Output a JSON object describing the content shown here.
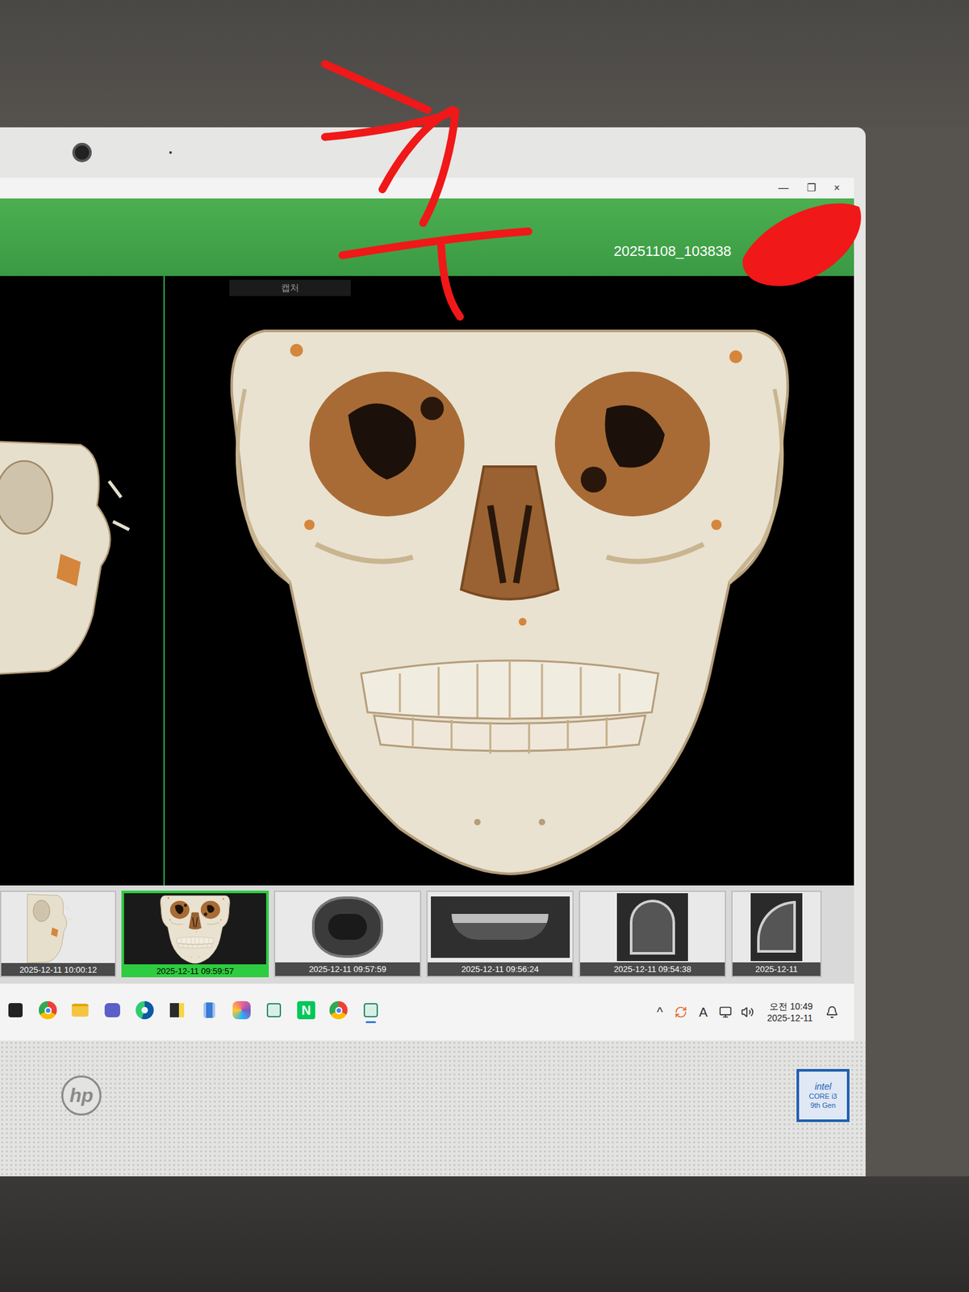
{
  "window": {
    "title": "20251108_103838",
    "controls": [
      "—",
      "❐",
      "×"
    ]
  },
  "viewer": {
    "tab_label": "캡처"
  },
  "thumbnails": [
    {
      "time": "2025-12-11 10:00:12",
      "selected": false,
      "kind": "3d-side"
    },
    {
      "time": "2025-12-11 09:59:57",
      "selected": true,
      "kind": "3d-front"
    },
    {
      "time": "2025-12-11 09:57:59",
      "selected": false,
      "kind": "axial"
    },
    {
      "time": "2025-12-11 09:56:24",
      "selected": false,
      "kind": "panoramic"
    },
    {
      "time": "2025-12-11 09:54:38",
      "selected": false,
      "kind": "ceph-front"
    },
    {
      "time": "2025-12-11",
      "selected": false,
      "kind": "ceph-side"
    }
  ],
  "taskbar": {
    "apps": [
      {
        "kind": "start",
        "active": false
      },
      {
        "kind": "chrome",
        "active": false
      },
      {
        "kind": "explorer",
        "active": false
      },
      {
        "kind": "teams",
        "active": false
      },
      {
        "kind": "edge",
        "active": false
      },
      {
        "kind": "sticky",
        "active": false
      },
      {
        "kind": "notepad",
        "active": false
      },
      {
        "kind": "copilot",
        "active": false
      },
      {
        "kind": "app",
        "active": false
      },
      {
        "kind": "naver",
        "label": "N",
        "active": false
      },
      {
        "kind": "chrome-user",
        "active": false
      },
      {
        "kind": "app",
        "active": true
      }
    ],
    "tray": [
      {
        "kind": "chevron",
        "label": "^"
      },
      {
        "kind": "sync"
      },
      {
        "kind": "ime",
        "label": "A"
      },
      {
        "kind": "display"
      },
      {
        "kind": "volume"
      }
    ],
    "time": "오전 10:49",
    "date": "2025-12-11"
  },
  "monitor": {
    "logo": "hp",
    "sticker": [
      "intel",
      "CORE i3",
      "9th Gen"
    ]
  }
}
